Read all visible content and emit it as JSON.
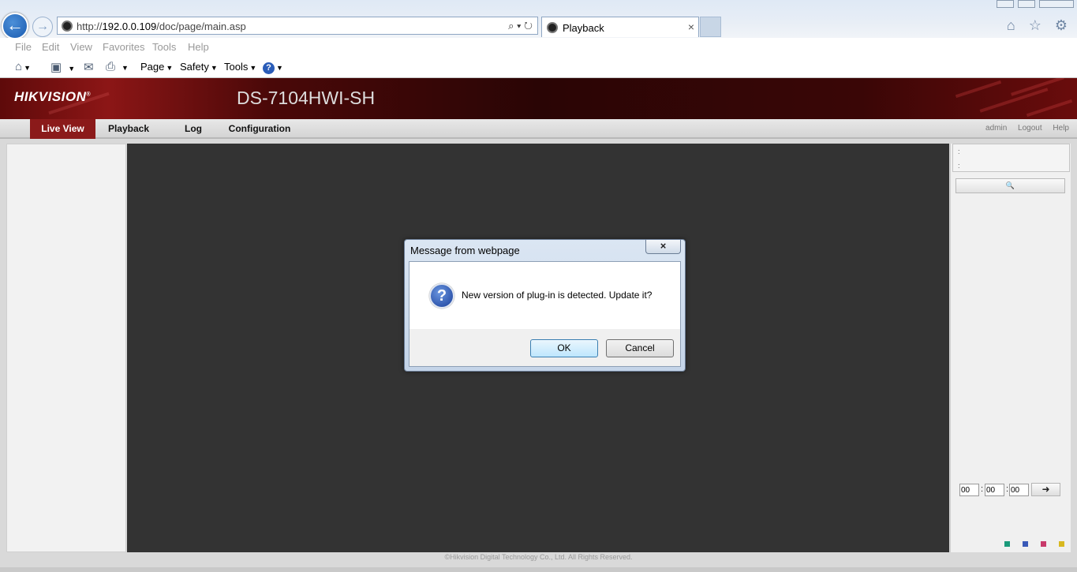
{
  "browser": {
    "url_prefix": "http://",
    "url_host": "192.0.0.109",
    "url_path": "/doc/page/main.asp",
    "tab_title": "Playback",
    "tab_close": "×",
    "back_glyph": "←",
    "forward_glyph": "→",
    "addr_tools": "⌕ ▾ ↻",
    "right_icons": "⌂ ☆ ⚙",
    "menu": [
      "File",
      "Edit",
      "View",
      "Favorites",
      "Tools",
      "Help"
    ],
    "command_bar": {
      "page": "Page",
      "safety": "Safety",
      "tools": "Tools",
      "help_glyph": "?"
    }
  },
  "app": {
    "logo": "HIKVISION",
    "logo_mark": "®",
    "model": "DS-7104HWI-SH",
    "brand_color": "#8b1a1a"
  },
  "nav": {
    "items": [
      "Live View",
      "Playback",
      "Log",
      "Configuration"
    ],
    "active": "Live View",
    "user": "admin",
    "logout": "Logout",
    "help": "Help"
  },
  "right_panel": {
    "info_line1": ":",
    "info_line2": ":",
    "search_glyph": "🔍",
    "time": {
      "hh": "00",
      "mm": "00",
      "ss": "00",
      "sep": ":",
      "go_glyph": "➜"
    },
    "color_squares": [
      "#1a9a7a",
      "#3a5ab8",
      "#c83a6a",
      "#d8b820"
    ]
  },
  "footer": {
    "copyright": "©Hikvision Digital Technology Co., Ltd. All Rights Reserved."
  },
  "dialog": {
    "title": "Message from webpage",
    "close": "×",
    "icon_glyph": "?",
    "message": "New version of plug-in is detected. Update it?",
    "ok": "OK",
    "cancel": "Cancel"
  }
}
